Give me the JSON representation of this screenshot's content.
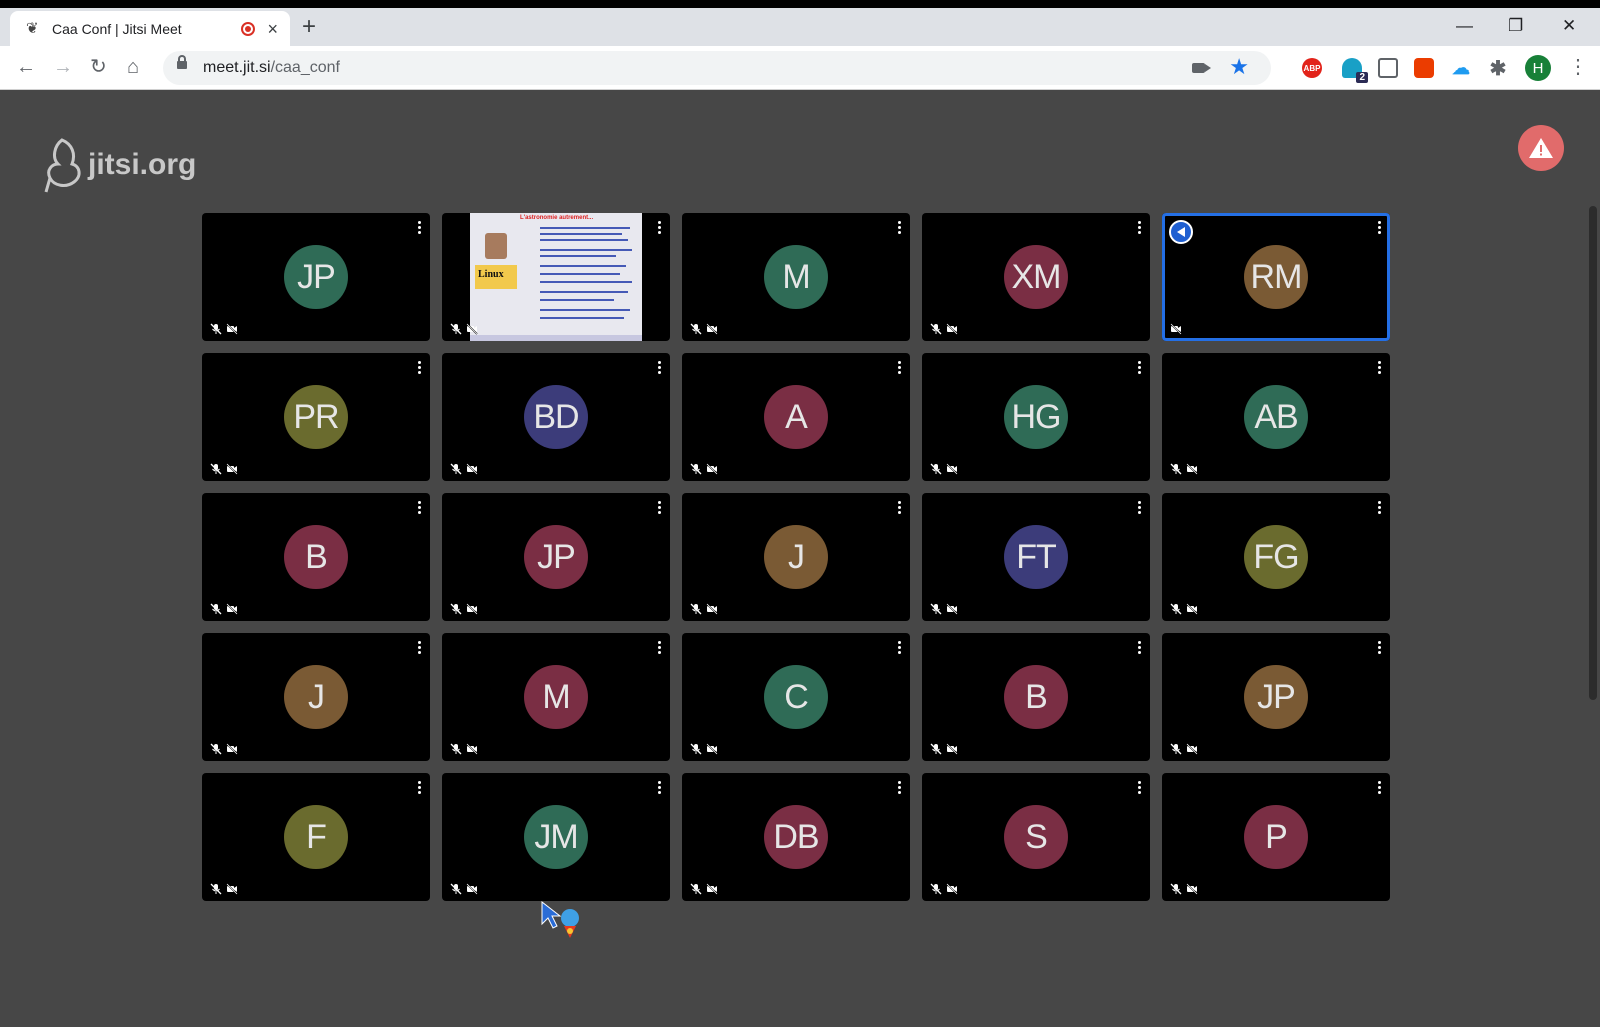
{
  "browser": {
    "tab_title": "Caa Conf | Jitsi Meet",
    "url_host": "meet.jit.si",
    "url_path": "/caa_conf",
    "new_tab": "+",
    "close_tab": "×",
    "profile_initial": "H",
    "ext_badge": "2",
    "abp_label": "ABP"
  },
  "jitsi": {
    "logo_text": "jitsi.org"
  },
  "participants": [
    {
      "initials": "JP",
      "color": "#2f6b56"
    },
    {
      "initials": "",
      "color": "",
      "screen_share": true,
      "share_title": "L'astronomie autrement...",
      "share_label": "Linux"
    },
    {
      "initials": "M",
      "color": "#2f6b56"
    },
    {
      "initials": "XM",
      "color": "#7a2e44"
    },
    {
      "initials": "RM",
      "color": "#7a5a34",
      "active_speaker": true
    },
    {
      "initials": "PR",
      "color": "#6a6b2e"
    },
    {
      "initials": "BD",
      "color": "#3c3c7a"
    },
    {
      "initials": "A",
      "color": "#7a2e44"
    },
    {
      "initials": "HG",
      "color": "#2f6b56"
    },
    {
      "initials": "AB",
      "color": "#2f6b56"
    },
    {
      "initials": "B",
      "color": "#7a2e44"
    },
    {
      "initials": "JP",
      "color": "#7a2e44"
    },
    {
      "initials": "J",
      "color": "#7a5a34"
    },
    {
      "initials": "FT",
      "color": "#3c3c7a"
    },
    {
      "initials": "FG",
      "color": "#6a6b2e"
    },
    {
      "initials": "J",
      "color": "#7a5a34"
    },
    {
      "initials": "M",
      "color": "#7a2e44"
    },
    {
      "initials": "C",
      "color": "#2f6b56"
    },
    {
      "initials": "B",
      "color": "#7a2e44"
    },
    {
      "initials": "JP",
      "color": "#7a5a34"
    },
    {
      "initials": "F",
      "color": "#6a6b2e"
    },
    {
      "initials": "JM",
      "color": "#2f6b56"
    },
    {
      "initials": "DB",
      "color": "#7a2e44"
    },
    {
      "initials": "S",
      "color": "#7a2e44"
    },
    {
      "initials": "P",
      "color": "#7a2e44"
    }
  ]
}
